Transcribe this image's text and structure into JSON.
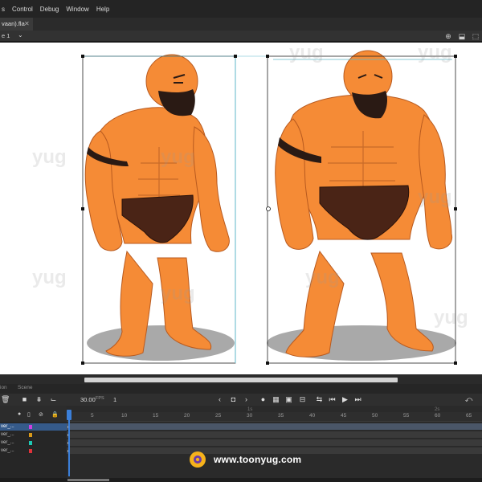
{
  "menubar": {
    "items": [
      "s",
      "Control",
      "Debug",
      "Window",
      "Help"
    ]
  },
  "document": {
    "tab_label": "vaan).fla",
    "close_glyph": "✕"
  },
  "edit_bar": {
    "scene_label": "e 1"
  },
  "timeline": {
    "panel_tabs": [
      "ion",
      "Scene"
    ],
    "fps": "30.00",
    "fps_unit": "FPS",
    "current_frame": "1",
    "ruler_ticks": [
      "5",
      "10",
      "15",
      "20",
      "25",
      "30",
      "35",
      "40",
      "45",
      "50",
      "55",
      "60",
      "65"
    ],
    "ruler_marks": [
      "1s",
      "2s"
    ],
    "layers": [
      {
        "name": "ver_...",
        "color": "#cf3fe0",
        "selected": true
      },
      {
        "name": "ver_...",
        "color": "#d99a1a",
        "selected": false
      },
      {
        "name": "ver_...",
        "color": "#1ec8b4",
        "selected": false
      },
      {
        "name": "ver_...",
        "color": "#e0323a",
        "selected": false
      }
    ]
  },
  "watermark": {
    "brand": "yug",
    "website": "www.toonyug.com"
  },
  "colors": {
    "skin": "#f58b36",
    "skin_dark": "#d8662a",
    "hair": "#2a1a14",
    "trunks": "#4a2416",
    "shadow": "#a9a9a9",
    "selection": "#3b7fd9"
  },
  "icons": [
    "chevron-down-icon",
    "camera-icon",
    "layers-icon",
    "graph-icon",
    "eye-icon",
    "lock-icon",
    "prev-keyframe-icon",
    "play-icon",
    "step-back-icon",
    "step-forward-icon",
    "loop-icon",
    "onion-skin-icon",
    "undo-icon"
  ]
}
